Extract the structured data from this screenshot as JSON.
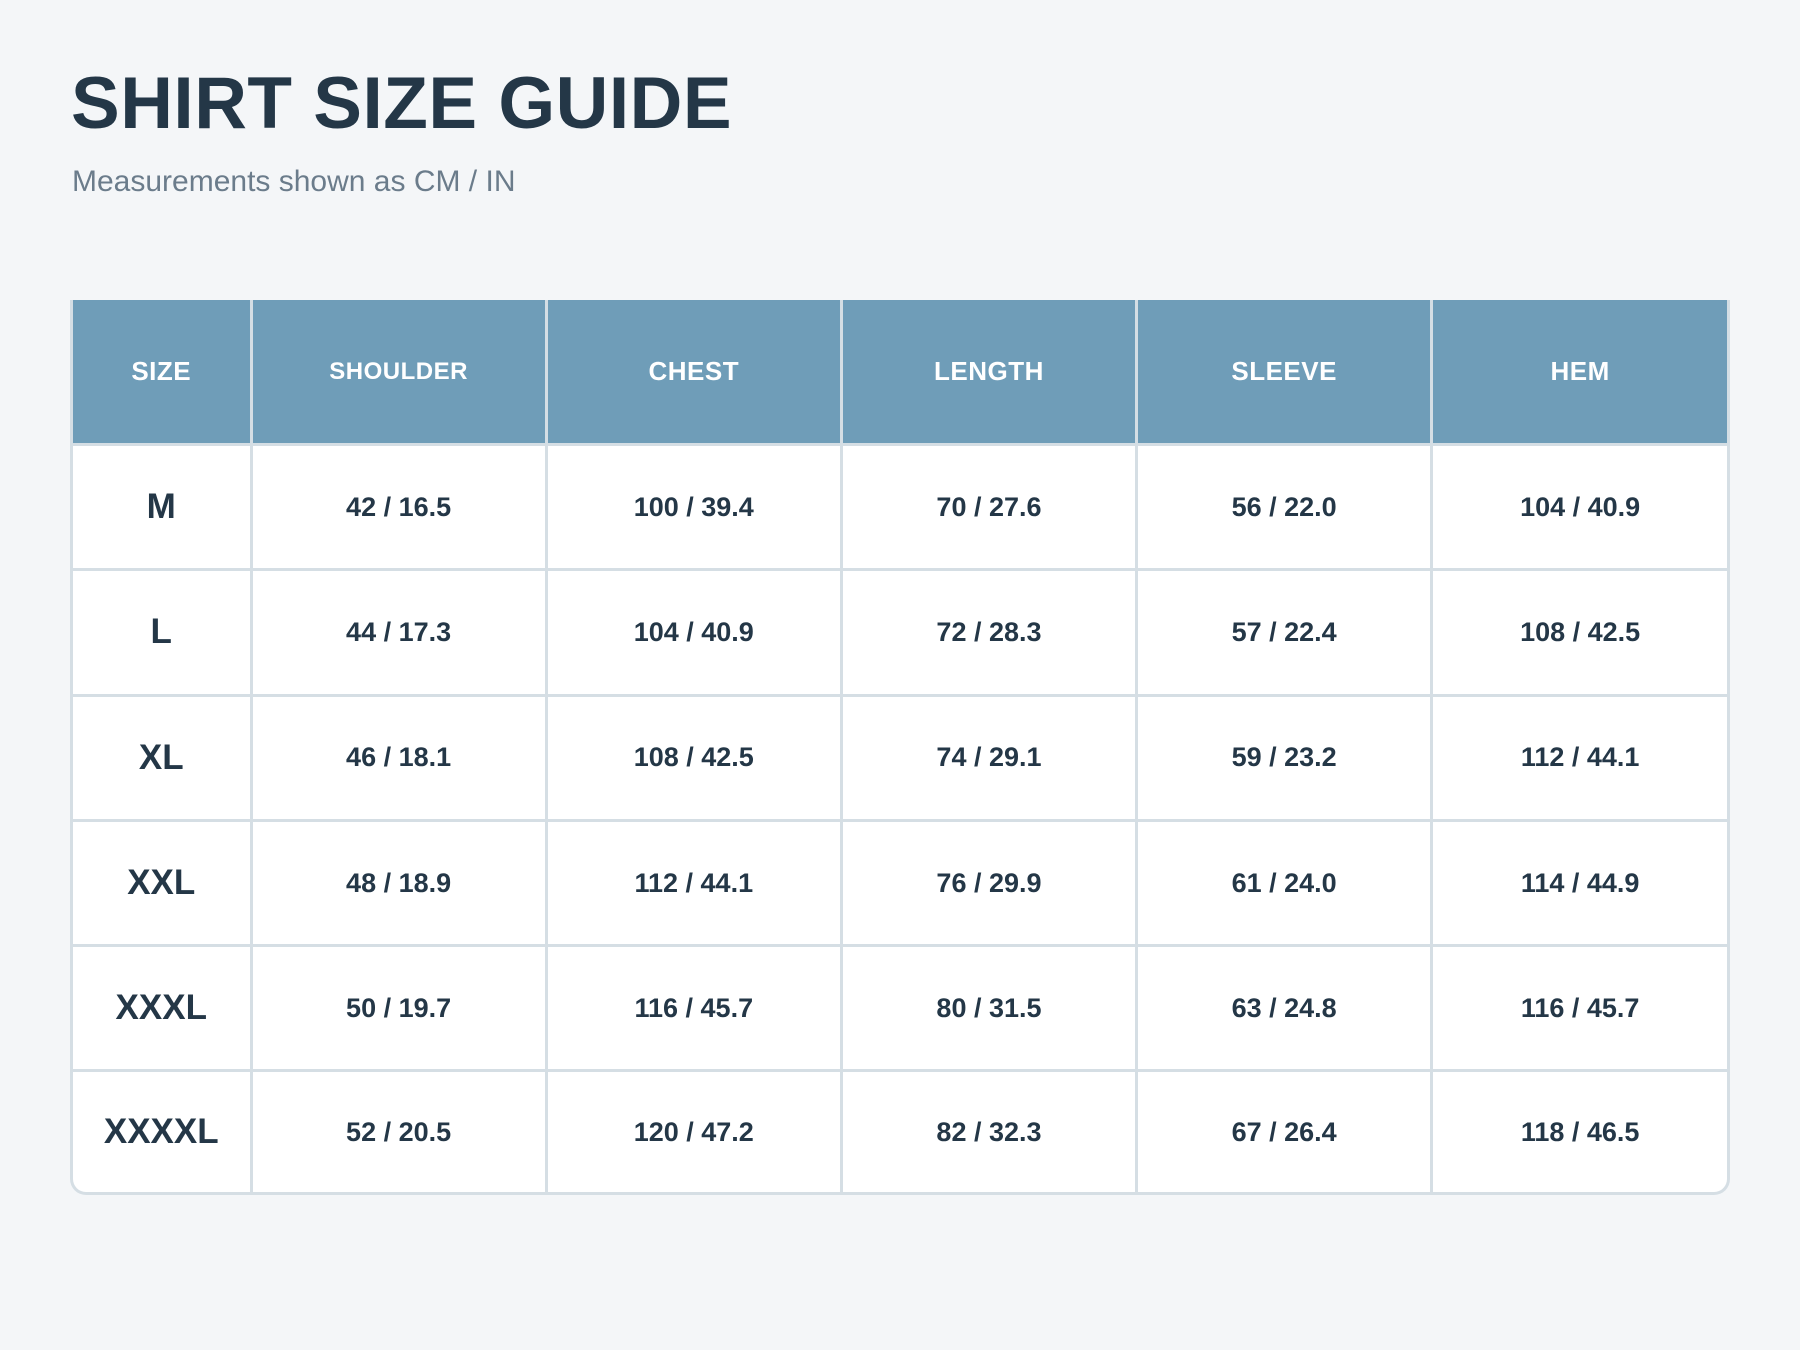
{
  "title": "SHIRT SIZE GUIDE",
  "subtitle": "Measurements shown as CM / IN",
  "table": {
    "headers": [
      "SIZE",
      "SHOULDER",
      "CHEST",
      "LENGTH",
      "SLEEVE",
      "HEM"
    ],
    "rows": [
      [
        "M",
        "42 / 16.5",
        "100 / 39.4",
        "70 / 27.6",
        "56 / 22.0",
        "104 / 40.9"
      ],
      [
        "L",
        "44 / 17.3",
        "104 / 40.9",
        "72 / 28.3",
        "57 / 22.4",
        "108 / 42.5"
      ],
      [
        "XL",
        "46 / 18.1",
        "108 / 42.5",
        "74 / 29.1",
        "59 / 23.2",
        "112 / 44.1"
      ],
      [
        "XXL",
        "48 / 18.9",
        "112 / 44.1",
        "76 / 29.9",
        "61 / 24.0",
        "114 / 44.9"
      ],
      [
        "XXXL",
        "50 / 19.7",
        "116 / 45.7",
        "80 / 31.5",
        "63 / 24.8",
        "116 / 45.7"
      ],
      [
        "XXXXL",
        "52 / 20.5",
        "120 / 47.2",
        "82 / 32.3",
        "67 / 26.4",
        "118 / 46.5"
      ]
    ]
  },
  "colors": {
    "header_bg": "#6f9db8",
    "text": "#243747",
    "subtitle": "#6b7c8b",
    "border": "#d5dee4",
    "page_bg": "#f4f6f8"
  }
}
